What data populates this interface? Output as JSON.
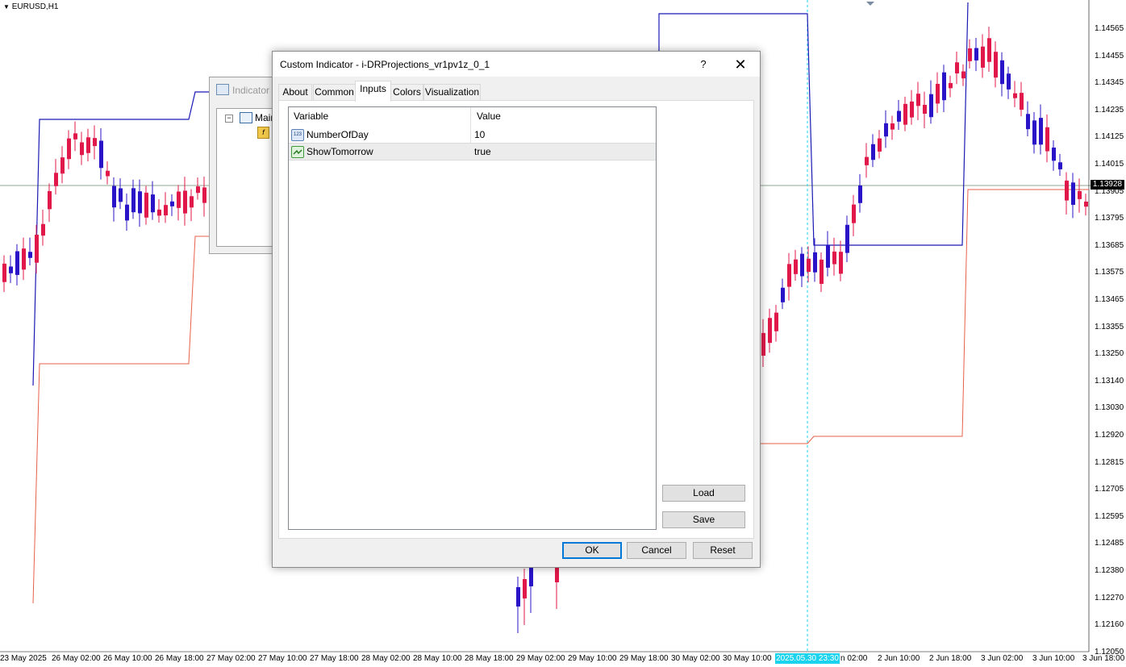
{
  "chart": {
    "symbol": "EURUSD,H1",
    "current_price": "1.13928",
    "crosshair_time": "2025.05.30 23:30",
    "price_axis": [
      "1.14565",
      "1.14455",
      "1.14345",
      "1.14235",
      "1.14125",
      "1.14015",
      "1.13905",
      "1.13795",
      "1.13685",
      "1.13575",
      "1.13465",
      "1.13355",
      "1.13250",
      "1.13140",
      "1.13030",
      "1.12920",
      "1.12815",
      "1.12705",
      "1.12595",
      "1.12485",
      "1.12380",
      "1.12270",
      "1.12160",
      "1.12050"
    ],
    "time_axis": [
      "23 May 2025",
      "26 May 02:00",
      "26 May 10:00",
      "26 May 18:00",
      "27 May 02:00",
      "27 May 10:00",
      "27 May 18:00",
      "28 May 02:00",
      "28 May 10:00",
      "28 May 18:00",
      "29 May 02:00",
      "29 May 10:00",
      "29 May 18:00",
      "30 May 02:00",
      "30 May 10:00",
      "n 02:00",
      "2 Jun 10:00",
      "2 Jun 18:00",
      "3 Jun 02:00",
      "3 Jun 10:00",
      "3 Jun 18:00"
    ],
    "colors": {
      "bull": "#2a14c8",
      "bear": "#e0194a",
      "upper_line": "#1a1ab4",
      "lower_line": "#e8604a",
      "crosshair": "#1ad3ef",
      "grid_line": "#6e8c6e"
    }
  },
  "background_window": {
    "title": "Indicator",
    "tree_item": "Main"
  },
  "dialog": {
    "title": "Custom Indicator - i-DRProjections_vr1pv1z_0_1",
    "help": "?",
    "close": "✕",
    "tabs": [
      "About",
      "Common",
      "Inputs",
      "Colors",
      "Visualization"
    ],
    "active_tab": "Inputs",
    "table": {
      "headers": [
        "Variable",
        "Value"
      ],
      "rows": [
        {
          "variable": "NumberOfDay",
          "value": "10",
          "icon": "integer-icon"
        },
        {
          "variable": "ShowTomorrow",
          "value": "true",
          "icon": "boolean-icon"
        }
      ]
    },
    "buttons": {
      "load": "Load",
      "save": "Save",
      "ok": "OK",
      "cancel": "Cancel",
      "reset": "Reset"
    }
  }
}
